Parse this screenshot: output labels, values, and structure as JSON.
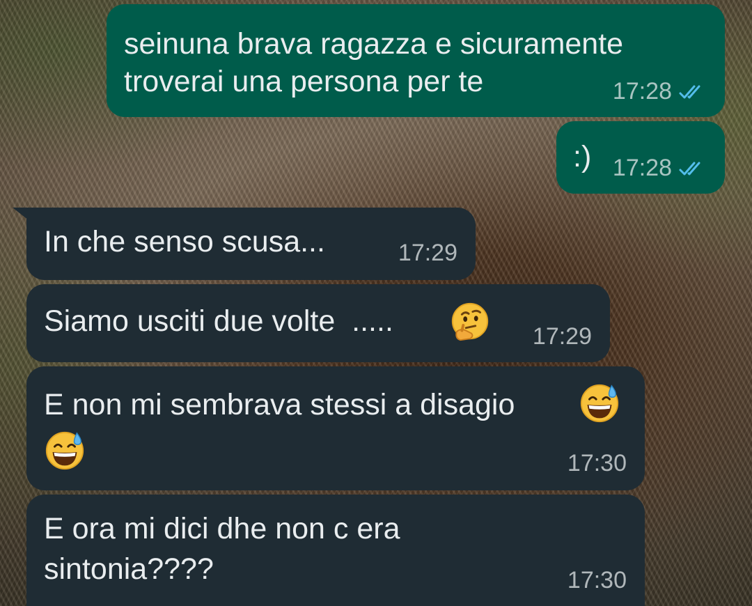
{
  "messages": [
    {
      "direction": "outgoing",
      "lines": [
        "seinuna brava ragazza e sicuramente",
        "troverai una persona per te"
      ],
      "time": "17:28",
      "status": "read"
    },
    {
      "direction": "outgoing",
      "lines": [
        ":)"
      ],
      "time": "17:28",
      "status": "read"
    },
    {
      "direction": "incoming",
      "lines": [
        "In che senso scusa..."
      ],
      "time": "17:29"
    },
    {
      "direction": "incoming",
      "lines": [
        "Siamo usciti due volte  ....."
      ],
      "emoji": "thinking-face-emoji",
      "time": "17:29"
    },
    {
      "direction": "incoming",
      "lines": [
        "E non mi sembrava stessi a disagio"
      ],
      "emoji": "grinning-face-with-sweat-emoji",
      "time": "17:30"
    },
    {
      "direction": "incoming",
      "lines": [
        "E ora mi dici dhe non c era",
        "sintonia????"
      ],
      "time": "17:30"
    }
  ],
  "colors": {
    "outgoing_bubble": "#005c4b",
    "incoming_bubble": "#1f2c34",
    "text": "#e9edef",
    "read_ticks": "#53bdeb"
  },
  "icons": [
    "double-check-read-icon",
    "thinking-face-emoji",
    "grinning-face-with-sweat-emoji"
  ]
}
